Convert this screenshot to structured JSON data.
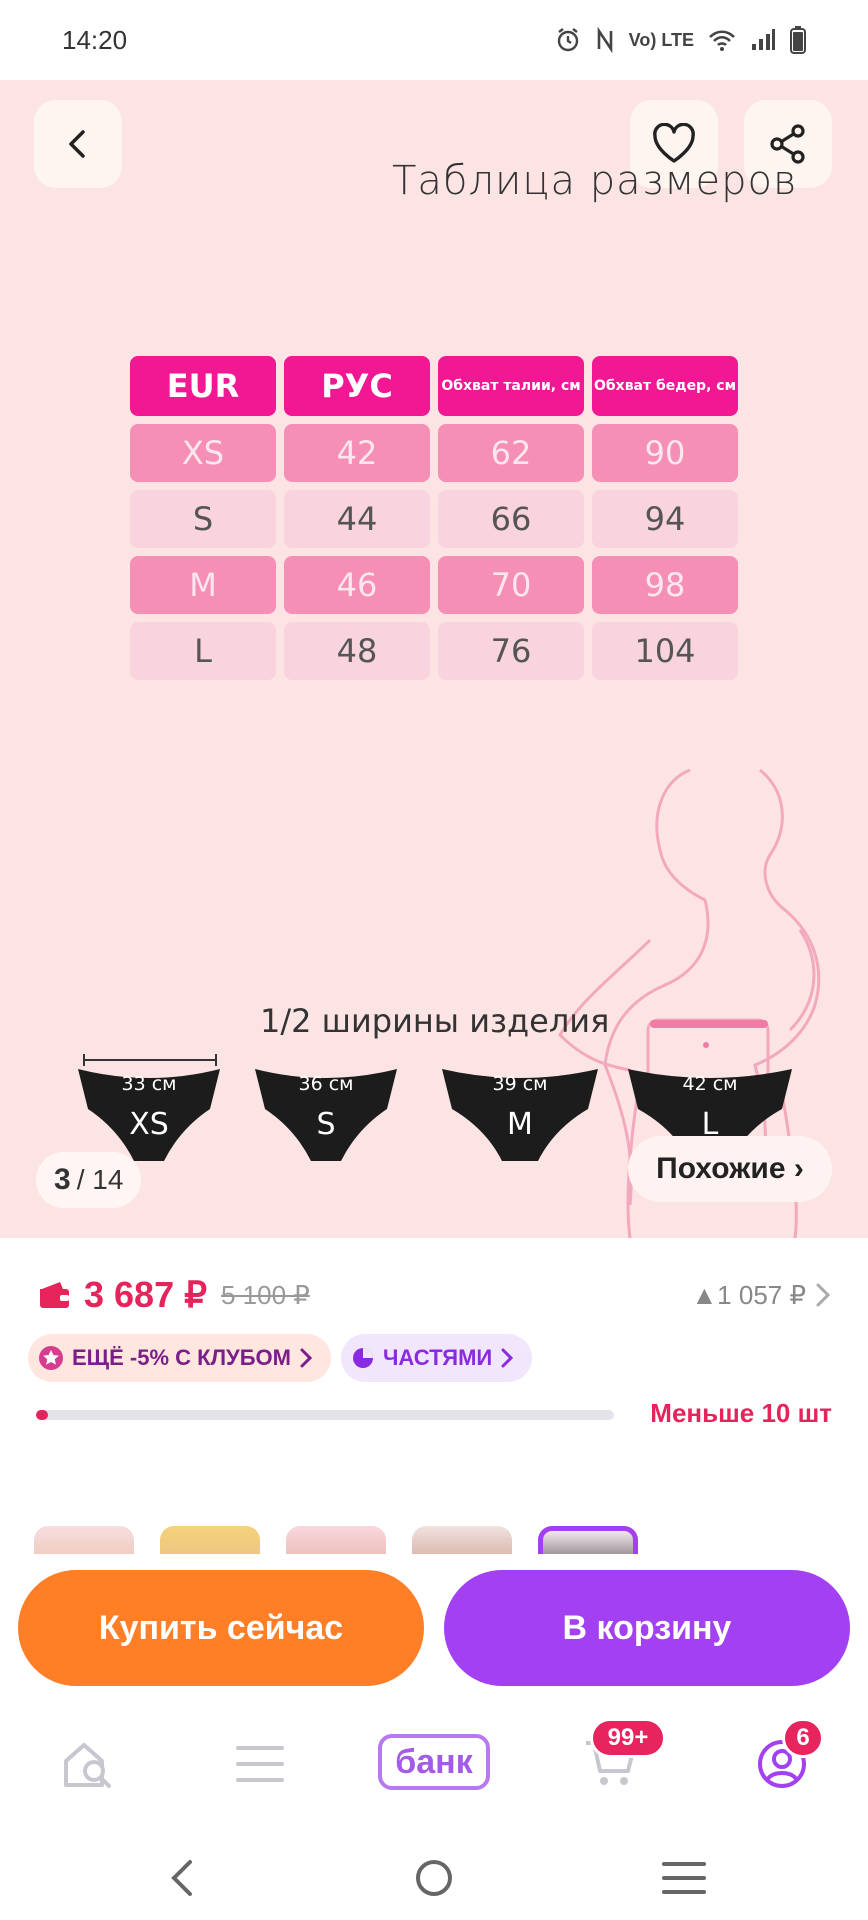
{
  "status_bar": {
    "time": "14:20",
    "icons": [
      "alarm-icon",
      "nfc-icon",
      "volte-icon",
      "wifi-icon",
      "signal-icon",
      "battery-icon"
    ],
    "volte_text": "Vo) LTE"
  },
  "gallery": {
    "image_title": "Таблица размеров",
    "table": {
      "headers": [
        "EUR",
        "РУС",
        "Обхват талии, см",
        "Обхват бедер, см"
      ],
      "rows": [
        [
          "XS",
          "42",
          "62",
          "90"
        ],
        [
          "S",
          "44",
          "66",
          "94"
        ],
        [
          "M",
          "46",
          "70",
          "98"
        ],
        [
          "L",
          "48",
          "76",
          "104"
        ]
      ]
    },
    "half_width_label": "1/2 ширины изделия",
    "panties": [
      {
        "cm": "33 см",
        "size": "XS"
      },
      {
        "cm": "36 см",
        "size": "S"
      },
      {
        "cm": "39 см",
        "size": "M"
      },
      {
        "cm": "42 см",
        "size": "L"
      }
    ],
    "counter": {
      "current": "3",
      "total": "/ 14"
    },
    "similar_label": "Похожие ›"
  },
  "price": {
    "current": "3 687 ₽",
    "old": "5 100 ₽",
    "bonus": "▲1 057 ₽",
    "club_chip": "ЕЩЁ -5% С КЛУБОМ",
    "parts_chip": "ЧАСТЯМИ",
    "stock_label": "Меньше 10 шт",
    "stock_fraction": 0.02
  },
  "buttons": {
    "buy_now": "Купить сейчас",
    "add_to_cart": "В корзину"
  },
  "nav": {
    "bank_label": "банк",
    "cart_badge": "99+",
    "profile_badge": "6"
  },
  "colors": {
    "accent_pink": "#f21893",
    "price_red": "#e5245c",
    "buy_orange": "#ff7e26",
    "cart_purple": "#a340f2",
    "bank_purple": "#a45be8"
  }
}
